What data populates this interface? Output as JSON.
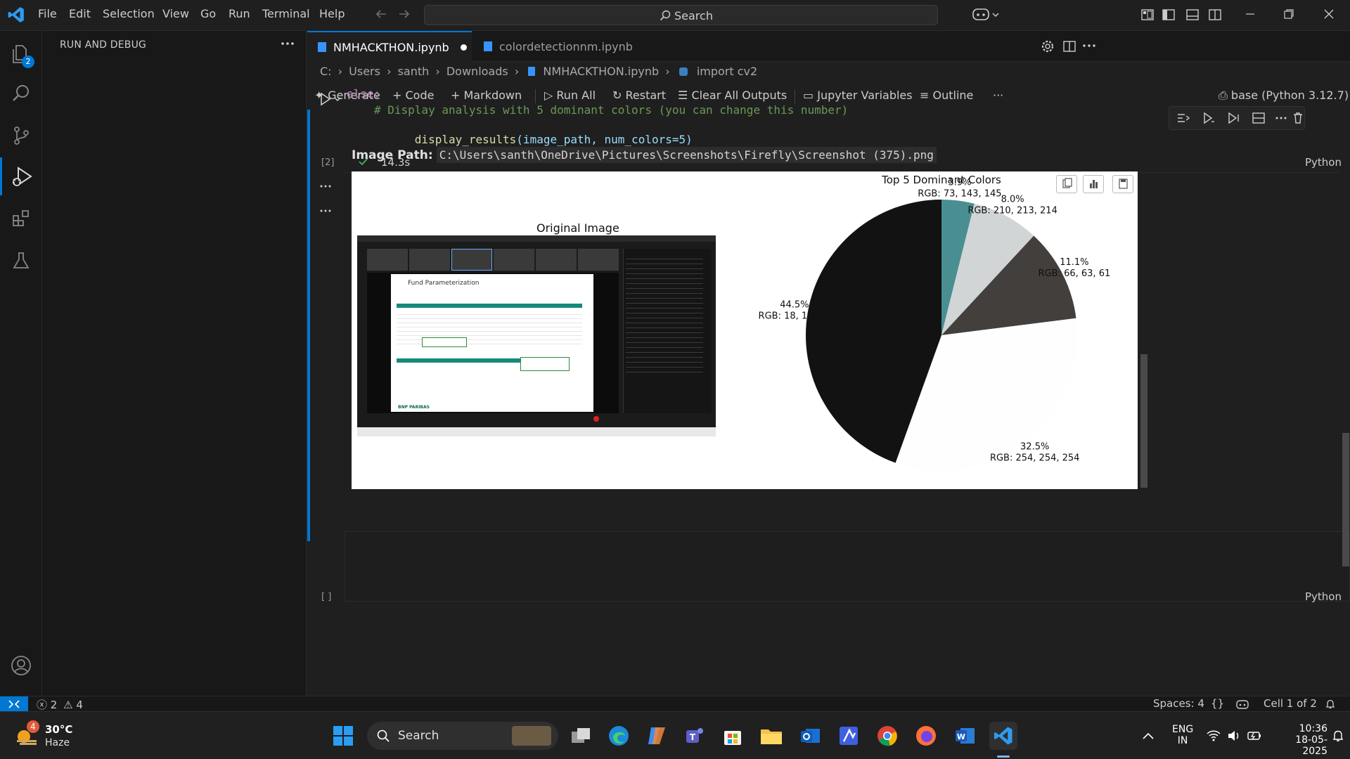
{
  "titlebar": {
    "menus": [
      "File",
      "Edit",
      "Selection",
      "View",
      "Go",
      "Run",
      "Terminal",
      "Help"
    ],
    "search_label": "Search"
  },
  "activitybar": {
    "explorer_badge": "2"
  },
  "sidebar": {
    "title": "RUN AND DEBUG"
  },
  "tabs": [
    {
      "label": "NMHACKTHON.ipynb"
    },
    {
      "label": "colordetectionnm.ipynb"
    }
  ],
  "breadcrumb": {
    "c": "C:",
    "users": "Users",
    "santh": "santh",
    "downloads": "Downloads",
    "file": "NMHACKTHON.ipynb",
    "symbol": "import cv2"
  },
  "toolbar": {
    "generate": "Generate",
    "code": "Code",
    "markdown": "Markdown",
    "run_all": "Run All",
    "restart": "Restart",
    "clear": "Clear All Outputs",
    "variables": "Jupyter Variables",
    "outline": "Outline",
    "kernel": "base (Python 3.12.7)"
  },
  "cell1": {
    "line1": "else:",
    "line2": "# Display analysis with 5 dominant colors (you can change this number)",
    "line3_fn": "display_results",
    "line3_args": "(image_path, num_colors=5)",
    "exec_count": "[2]",
    "time": "14.3s",
    "language": "Python"
  },
  "output": {
    "path_label": "Image Path:",
    "path_value": "C:\\Users\\santh\\OneDrive\\Pictures\\Screenshots\\Firefly\\Screenshot (375).png",
    "original_title": "Original Image",
    "inner_title": "Fund Parameterization",
    "inner_brand": "BNP PARIBAS"
  },
  "chart_data": {
    "type": "pie",
    "title": "Top 5 Dominant Colors",
    "slices": [
      {
        "percent": 3.9,
        "label": "3.9%",
        "rgb_label": "RGB: 73, 143, 145",
        "color": "#498f91"
      },
      {
        "percent": 8.0,
        "label": "8.0%",
        "rgb_label": "RGB: 210, 213, 214",
        "color": "#d2d5d6"
      },
      {
        "percent": 11.1,
        "label": "11.1%",
        "rgb_label": "RGB: 66, 63, 61",
        "color": "#423f3d"
      },
      {
        "percent": 32.5,
        "label": "32.5%",
        "rgb_label": "RGB: 254, 254, 254",
        "color": "#fefefe"
      },
      {
        "percent": 44.5,
        "label": "44.5%",
        "rgb_label": "RGB: 18, 18, 18",
        "color": "#121212"
      }
    ],
    "start_angle_deg": 90,
    "direction": "clockwise"
  },
  "cell2": {
    "exec_count": "[ ]",
    "language": "Python"
  },
  "statusbar": {
    "errors": "2",
    "warnings": "4",
    "spaces": "Spaces: 4",
    "braces": "{}",
    "cell": "Cell 1 of 2"
  },
  "taskbar": {
    "weather_badge": "4",
    "temp": "30°C",
    "condition": "Haze",
    "search": "Search",
    "lang1": "ENG",
    "lang2": "IN",
    "time": "10:36",
    "date": "18-05-2025"
  },
  "colors": {
    "accent": "#0078d4",
    "success": "#3fb950"
  }
}
